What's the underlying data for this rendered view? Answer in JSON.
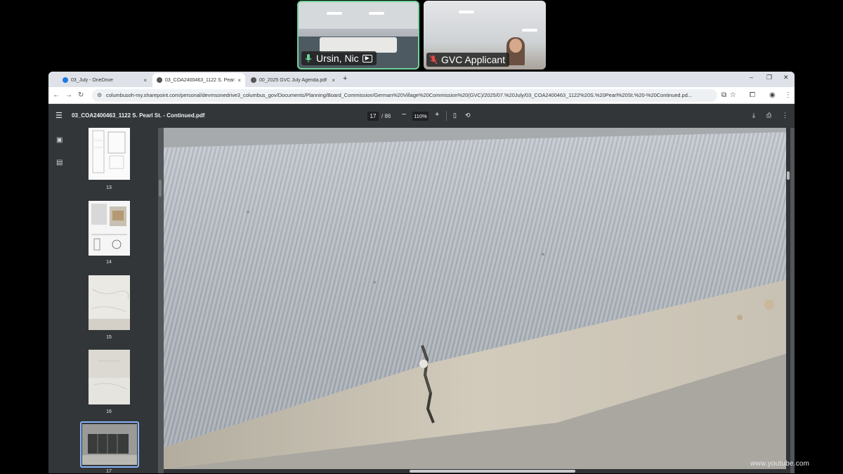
{
  "video": {
    "participants": [
      {
        "name": "Ursin, Nic",
        "mic": "active",
        "sharing": true
      },
      {
        "name": "GVC Applicant",
        "mic": "muted",
        "sharing": false
      }
    ]
  },
  "browser": {
    "tabs": [
      {
        "label": "03_July - OneDrive",
        "close": "×"
      },
      {
        "label": "03_COA2400463_1122 S. Pearl",
        "close": "×"
      },
      {
        "label": "00_2025 GVC July Agenda.pdf",
        "close": "×"
      }
    ],
    "new_tab": "+",
    "window_controls": {
      "minimize": "–",
      "maximize": "❐",
      "close": "✕"
    },
    "url": "columbusoh-my.sharepoint.com/personal/devmsonedrive3_columbus_gov/Documents/Planning/Board_Commission/German%20Village%20Commission%20(GVC)/2025/07.%20July/03_COA2400463_1122%20S.%20Pearl%20St.%20-%20Continued.pd..."
  },
  "pdf": {
    "title": "03_COA2400463_1122 S. Pearl St. - Continued.pdf",
    "current_page": "17",
    "total_pages": "/ 86",
    "zoom": "110%",
    "thumbnails": [
      {
        "page": "13"
      },
      {
        "page": "14"
      },
      {
        "page": "15"
      },
      {
        "page": "16"
      },
      {
        "page": "17",
        "selected": true
      }
    ]
  },
  "colors": {
    "accent_active_speaker": "#6fd39a",
    "pdf_toolbar": "#323639",
    "selected_thumb_border": "#8ab4f8"
  },
  "watermark": "www.youtube.com"
}
